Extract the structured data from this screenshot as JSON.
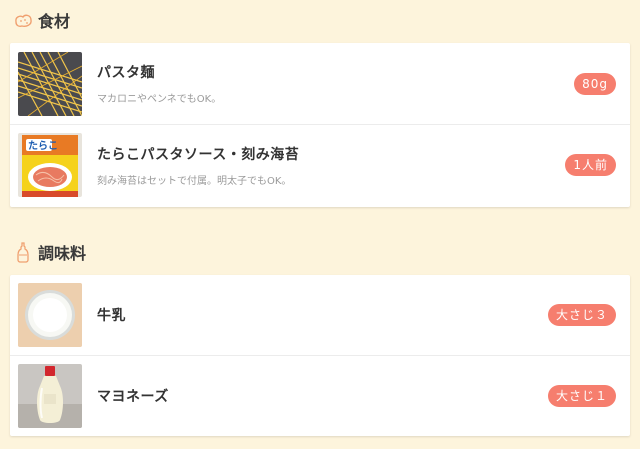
{
  "sections": [
    {
      "title": "食材",
      "icon": "potato-icon",
      "items": [
        {
          "name": "パスタ麺",
          "note": "マカロニやペンネでもOK。",
          "amount": "80g",
          "thumb": "pasta-noodles-photo"
        },
        {
          "name": "たらこパスタソース・刻み海苔",
          "note": "刻み海苔はセットで付属。明太子でもOK。",
          "amount": "1人前",
          "thumb": "tarako-sauce-package-photo"
        }
      ]
    },
    {
      "title": "調味料",
      "icon": "condiment-bottle-icon",
      "items": [
        {
          "name": "牛乳",
          "note": "",
          "amount": "大さじ３",
          "thumb": "milk-glass-photo"
        },
        {
          "name": "マヨネーズ",
          "note": "",
          "amount": "大さじ１",
          "thumb": "mayonnaise-bottle-photo"
        }
      ]
    }
  ],
  "colors": {
    "background": "#fdf4dc",
    "badge": "#f67e6e",
    "icon": "#f0a070"
  }
}
